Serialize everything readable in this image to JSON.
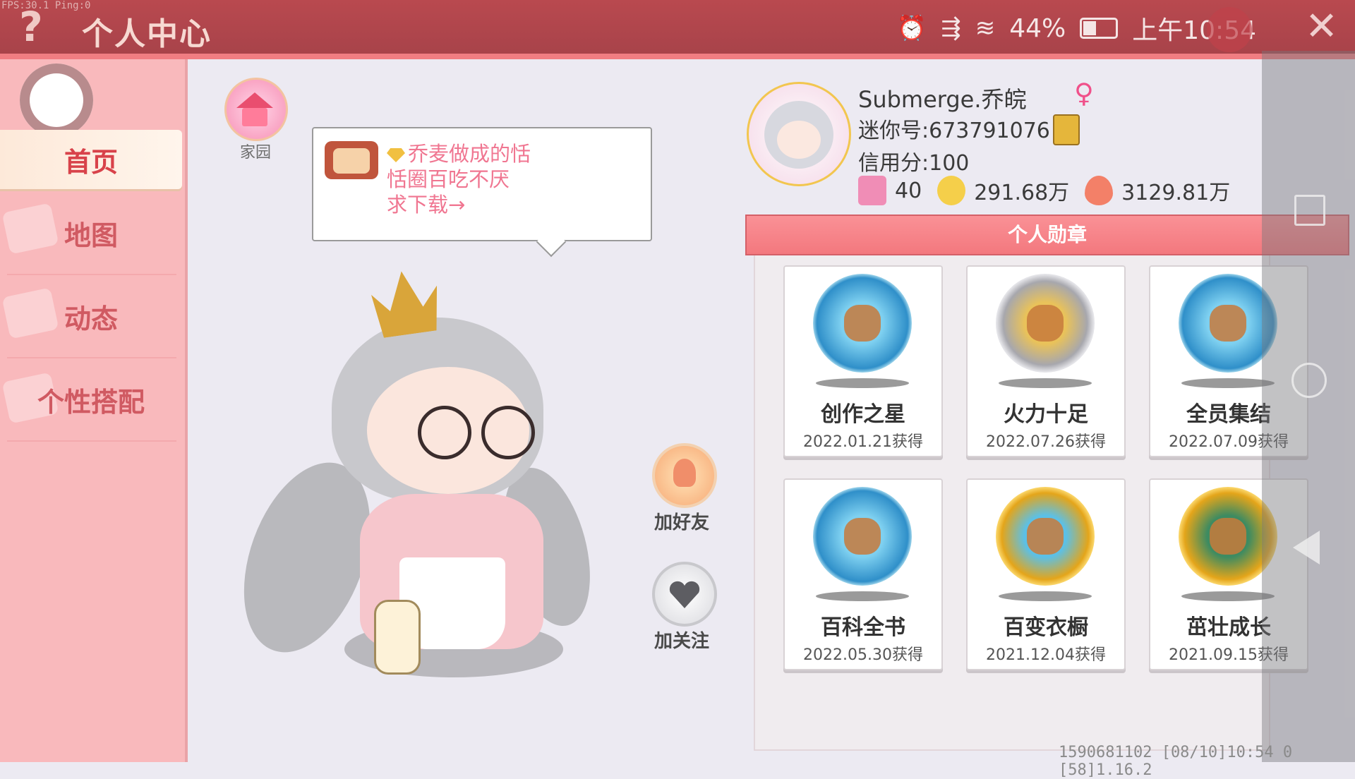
{
  "debug": {
    "fps": "FPS:30.1 Ping:0"
  },
  "header": {
    "title": "个人中心"
  },
  "status_bar": {
    "battery": "44%",
    "time": "上午10:54"
  },
  "sidebar": {
    "items": [
      {
        "label": "首页",
        "active": true
      },
      {
        "label": "地图",
        "active": false
      },
      {
        "label": "动态",
        "active": false
      },
      {
        "label": "个性搭配",
        "active": false
      }
    ]
  },
  "home": {
    "label": "家园"
  },
  "bubble": {
    "line1": "乔麦做成的恬",
    "line2": "恬圈百吃不厌",
    "line3": "求下载→"
  },
  "actions": {
    "add_friend": "加好友",
    "follow": "加关注"
  },
  "profile": {
    "username": "Submerge.乔皖",
    "gender_symbol": "♀",
    "mini_id": "迷你号:673791076",
    "credit": "信用分:100",
    "stat1": "40",
    "stat2": "291.68万",
    "stat3": "3129.81万"
  },
  "medals": {
    "title": "个人勋章",
    "items": [
      {
        "name": "创作之星",
        "date": "2022.01.21获得",
        "style": "blue"
      },
      {
        "name": "火力十足",
        "date": "2022.07.26获得",
        "style": "silver"
      },
      {
        "name": "全员集结",
        "date": "2022.07.09获得",
        "style": "blue"
      },
      {
        "name": "百科全书",
        "date": "2022.05.30获得",
        "style": "blue"
      },
      {
        "name": "百变衣橱",
        "date": "2021.12.04获得",
        "style": "gold"
      },
      {
        "name": "茁壮成长",
        "date": "2021.09.15获得",
        "style": "gold2"
      }
    ]
  },
  "footer": {
    "text": "1590681102   [08/10]10:54 0  [58]1.16.2"
  }
}
